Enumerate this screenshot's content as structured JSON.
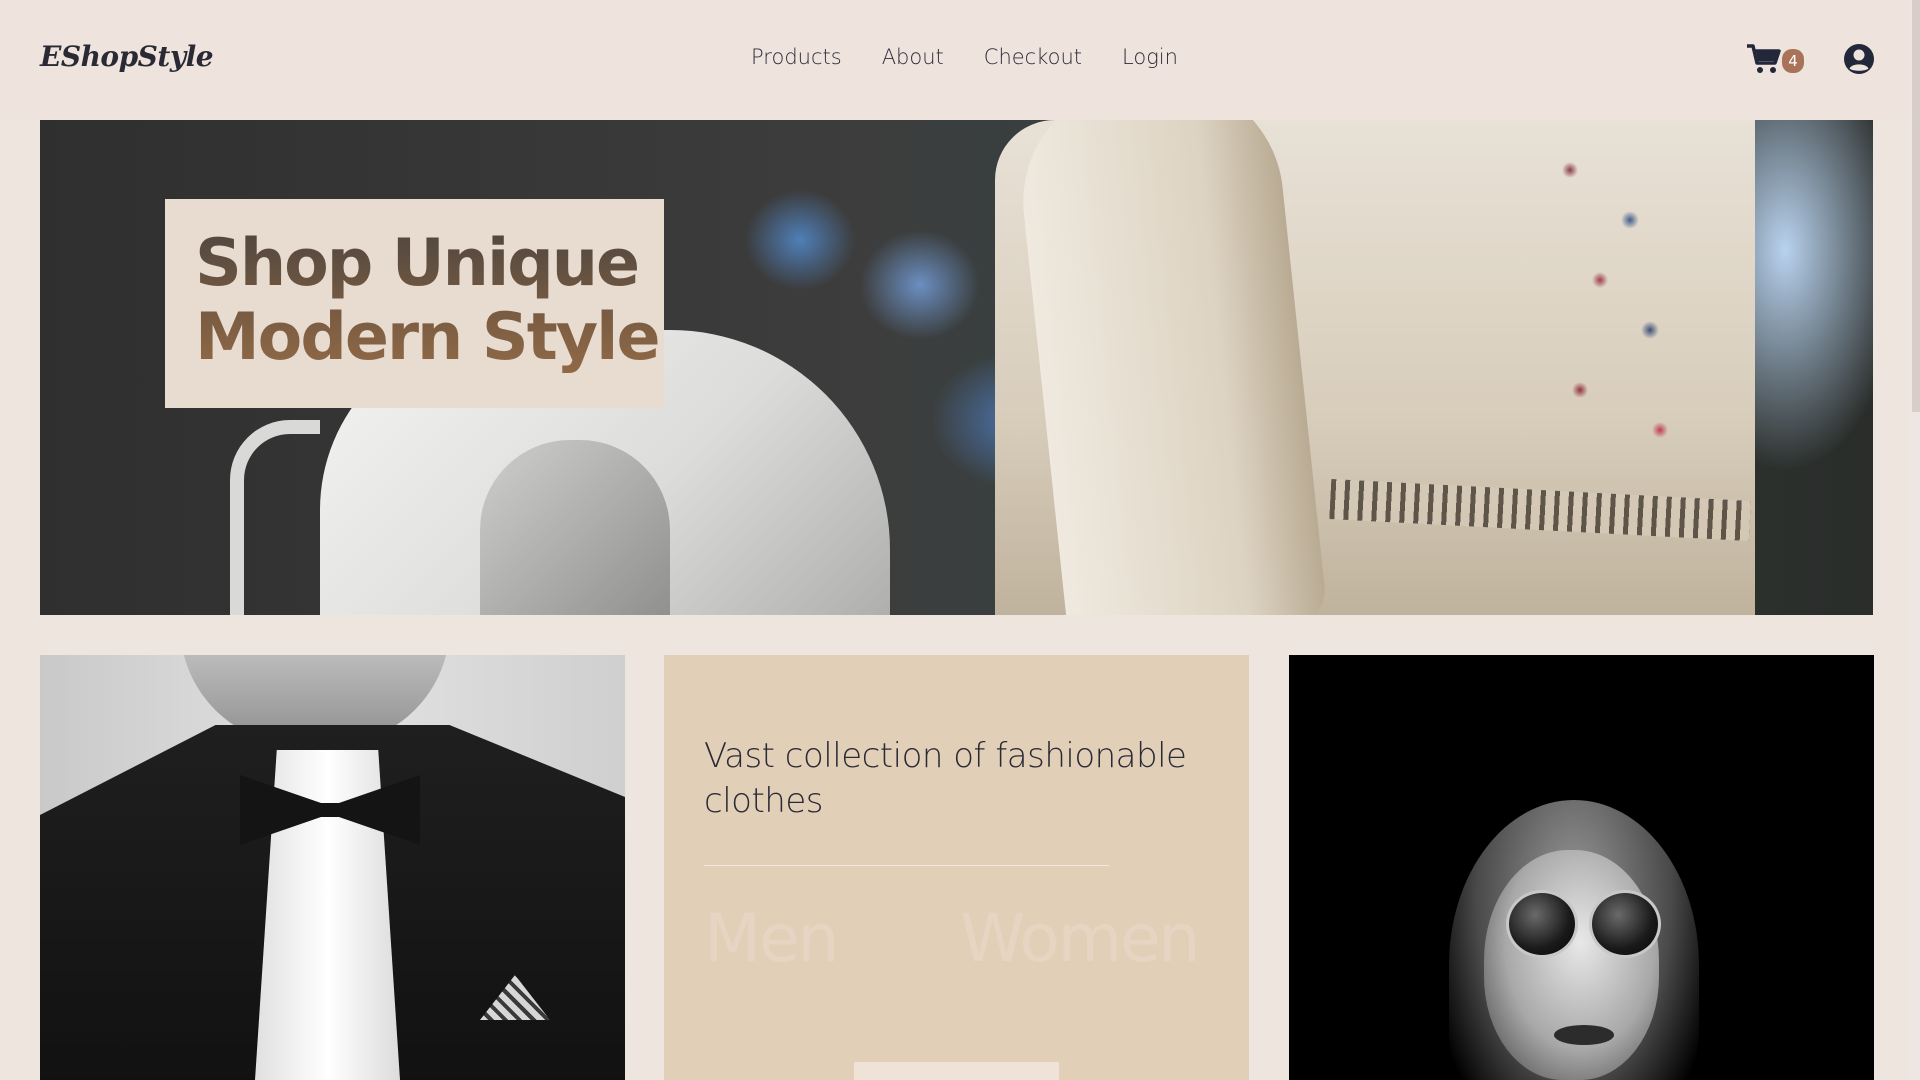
{
  "header": {
    "logo": "EShopStyle",
    "nav": [
      "Products",
      "About",
      "Checkout",
      "Login"
    ],
    "cart": {
      "icon": "shopping-cart-icon",
      "count": "4"
    },
    "user_icon": "user-circle-icon"
  },
  "hero": {
    "title": "Shop Unique\nModern Style"
  },
  "collection": {
    "text": "Vast collection of fashionable clothes",
    "categories": [
      "Men",
      "Women"
    ]
  },
  "colors": {
    "background": "#efe5df",
    "title_box": "#e8dcd0",
    "info_card": "#e2cfb8",
    "badge": "#a9735a",
    "text": "#2a2a35"
  }
}
